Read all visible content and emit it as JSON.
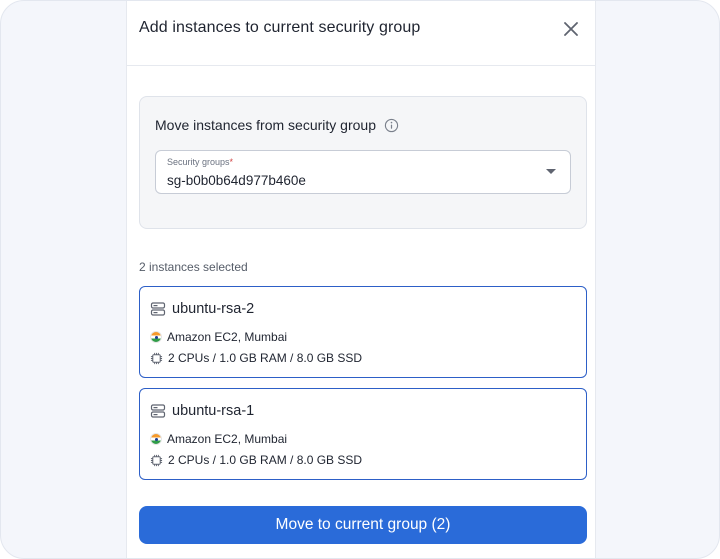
{
  "dialog": {
    "title": "Add instances to current security group",
    "close_icon": "close-icon"
  },
  "move_panel": {
    "title": "Move instances from security group",
    "info_icon": "info-icon",
    "select": {
      "label": "Security groups",
      "required_mark": "*",
      "value": "sg-b0b0b64d977b460e"
    }
  },
  "selection": {
    "count_text": "2 instances selected"
  },
  "instances": [
    {
      "name": "ubuntu-rsa-2",
      "location": "Amazon EC2, Mumbai",
      "specs": "2 CPUs / 1.0 GB RAM / 8.0 GB SSD",
      "icons": {
        "server": "server-icon",
        "flag": "india-flag-icon",
        "cpu": "cpu-icon"
      }
    },
    {
      "name": "ubuntu-rsa-1",
      "location": "Amazon EC2, Mumbai",
      "specs": "2 CPUs / 1.0 GB RAM / 8.0 GB SSD",
      "icons": {
        "server": "server-icon",
        "flag": "india-flag-icon",
        "cpu": "cpu-icon"
      }
    }
  ],
  "actions": {
    "move_label": "Move to current group (2)"
  },
  "colors": {
    "accent": "#2a6bd9",
    "card_border": "#2d5fc7",
    "panel_bg": "#f5f6f8",
    "backdrop": "#f4f6fb"
  }
}
